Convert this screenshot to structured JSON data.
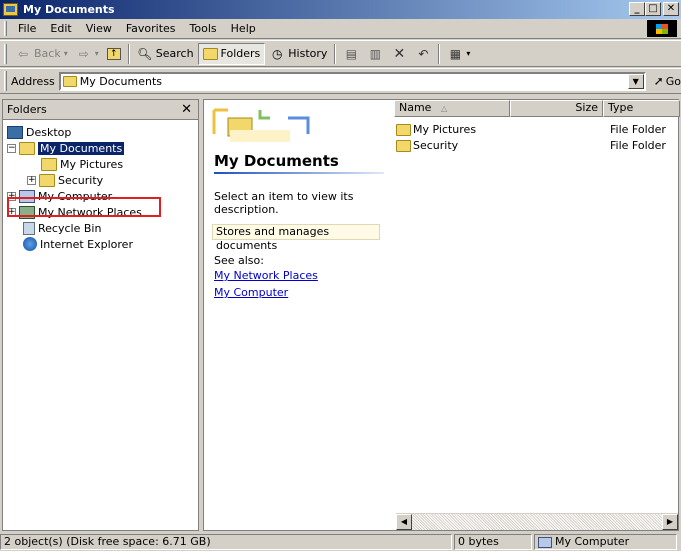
{
  "window": {
    "title": "My Documents"
  },
  "menu": [
    "File",
    "Edit",
    "View",
    "Favorites",
    "Tools",
    "Help"
  ],
  "toolbar": {
    "back": "Back",
    "search": "Search",
    "folders": "Folders",
    "history": "History"
  },
  "address": {
    "label": "Address",
    "value": "My Documents",
    "go": "Go"
  },
  "folders_pane": {
    "title": "Folders",
    "tree": [
      {
        "label": "Desktop",
        "icon": "desktop-icon"
      },
      {
        "label": "My Documents",
        "icon": "my-documents-icon",
        "selected": true
      },
      {
        "label": "My Pictures",
        "icon": "my-pictures-icon"
      },
      {
        "label": "Security",
        "icon": "folder-icon"
      },
      {
        "label": "My Computer",
        "icon": "computer-icon"
      },
      {
        "label": "My Network Places",
        "icon": "network-places-icon",
        "highlighted": true
      },
      {
        "label": "Recycle Bin",
        "icon": "recycle-bin-icon"
      },
      {
        "label": "Internet Explorer",
        "icon": "internet-explorer-icon"
      }
    ]
  },
  "webview": {
    "title": "My Documents",
    "description": "Select an item to view its description.",
    "info": "Stores and manages documents",
    "see_also": "See also:",
    "links": [
      "My Network Places",
      "My Computer"
    ]
  },
  "list": {
    "columns": {
      "name": "Name",
      "size": "Size",
      "type": "Type"
    },
    "rows": [
      {
        "name": "My Pictures",
        "size": "",
        "type": "File Folder"
      },
      {
        "name": "Security",
        "size": "",
        "type": "File Folder"
      }
    ]
  },
  "status": {
    "objects": "2 object(s) (Disk free space: 6.71 GB)",
    "size": "0 bytes",
    "zone": "My Computer"
  }
}
